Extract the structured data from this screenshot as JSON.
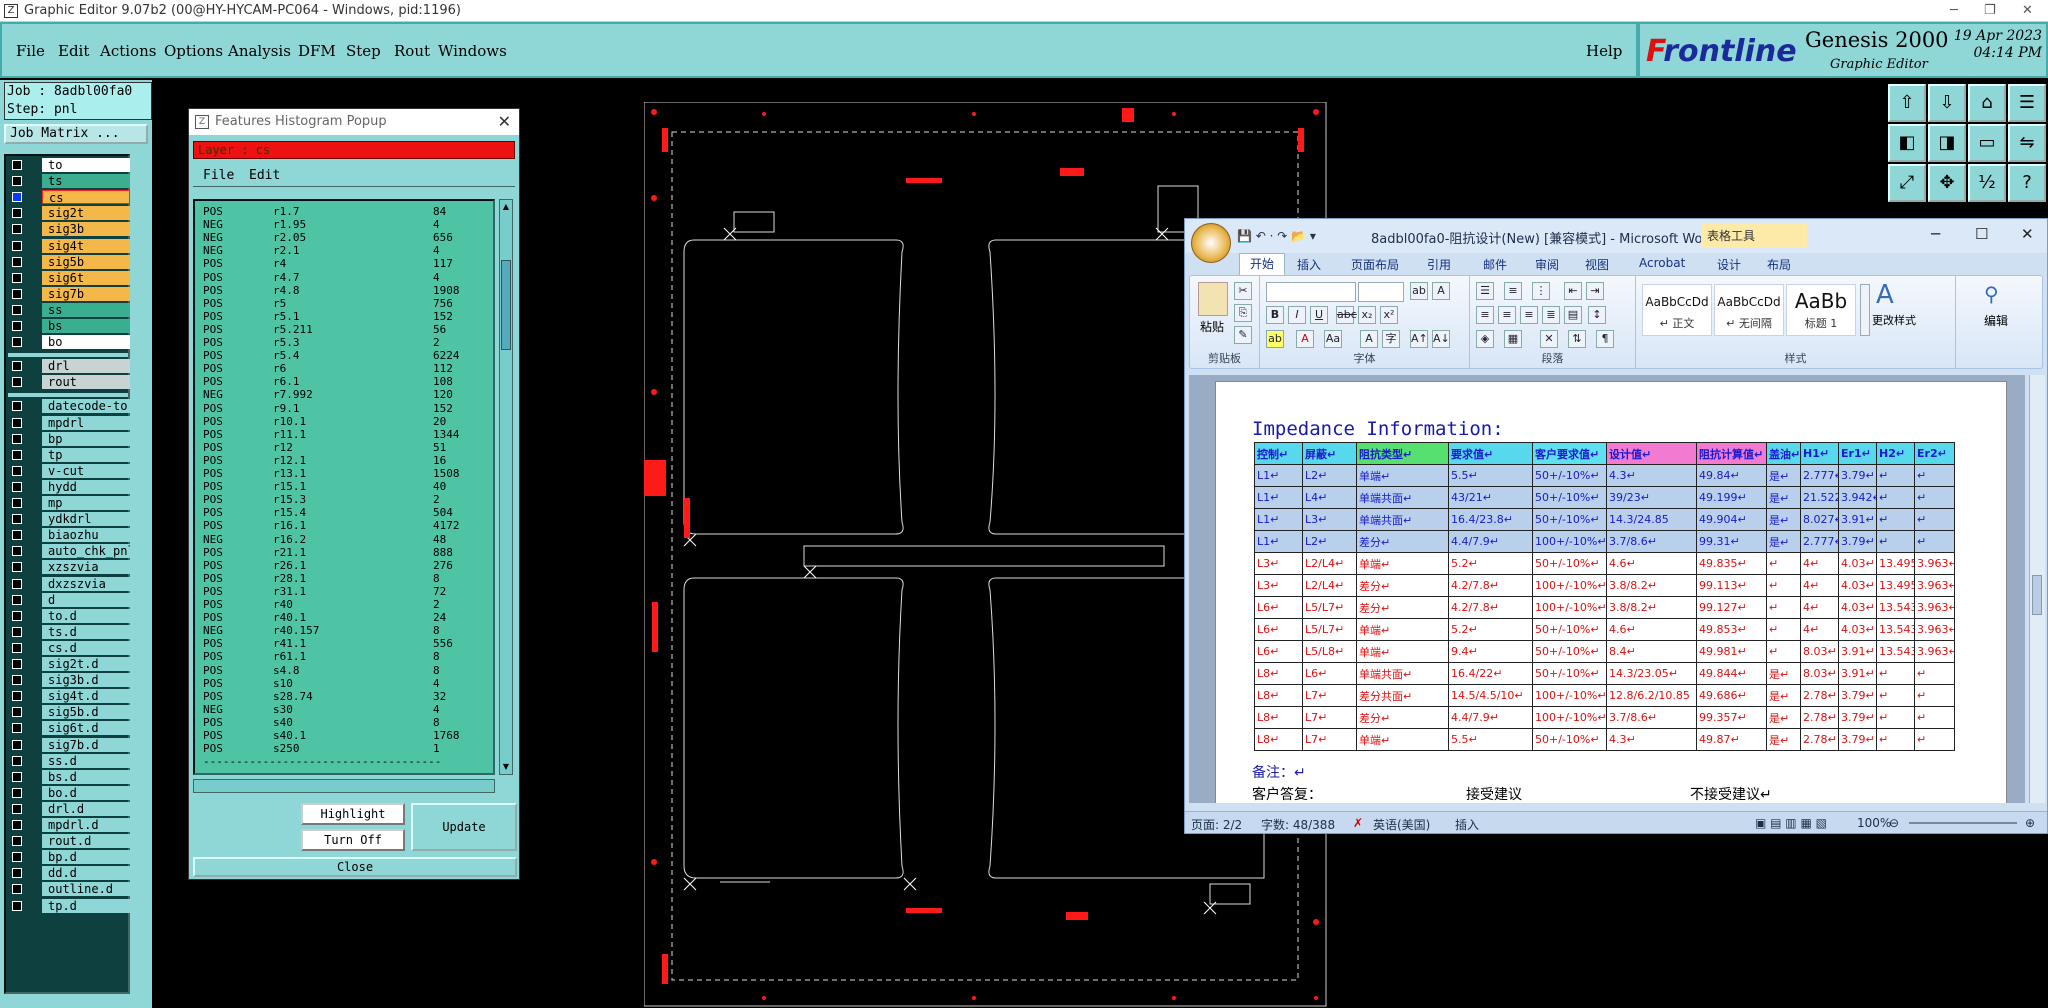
{
  "window": {
    "title": "Graphic Editor 9.07b2 (00@HY-HYCAM-PC064 - Windows, pid:1196)",
    "minimize": "─",
    "restore": "❐",
    "close": "✕"
  },
  "menu": [
    "File",
    "Edit",
    "Actions",
    "Options",
    "Analysis",
    "DFM",
    "Step",
    "Rout",
    "Windows"
  ],
  "help": "Help",
  "brand": {
    "logo_f": "F",
    "logo_rest": "rontline",
    "product": "Genesis 2000",
    "subtitle": "Graphic Editor",
    "date": "19 Apr 2023",
    "time": "04:14 PM"
  },
  "job": {
    "job_label": "Job : 8adbl00fa0",
    "step_label": "Step: pnl",
    "matrix_button": "Job Matrix ..."
  },
  "layers": [
    {
      "name": "to",
      "color": "#ffffff"
    },
    {
      "name": "ts",
      "color": "#3cae90"
    },
    {
      "name": "cs",
      "color": "#f4b84a",
      "active": true
    },
    {
      "name": "sig2t",
      "color": "#f4b84a"
    },
    {
      "name": "sig3b",
      "color": "#f4b84a"
    },
    {
      "name": "sig4t",
      "color": "#f4b84a"
    },
    {
      "name": "sig5b",
      "color": "#f4b84a"
    },
    {
      "name": "sig6t",
      "color": "#f4b84a"
    },
    {
      "name": "sig7b",
      "color": "#f4b84a"
    },
    {
      "name": "ss",
      "color": "#3cae90"
    },
    {
      "name": "bs",
      "color": "#3cae90"
    },
    {
      "name": "bo",
      "color": "#ffffff"
    }
  ],
  "drill_layers": [
    {
      "name": "drl",
      "color": "#c8d4d4"
    },
    {
      "name": "rout",
      "color": "#c8d4d4"
    }
  ],
  "misc_layers": [
    "datecode-to",
    "mpdrl",
    "bp",
    "tp",
    "v-cut",
    "hydd",
    "mp",
    "ydkdrl",
    "biaozhu",
    "auto_chk_pnl",
    "xzszvia",
    "dxzszvia",
    "d",
    "to.d",
    "ts.d",
    "cs.d",
    "sig2t.d",
    "sig3b.d",
    "sig4t.d",
    "sig5b.d",
    "sig6t.d",
    "sig7b.d",
    "ss.d",
    "bs.d",
    "bo.d",
    "drl.d",
    "mpdrl.d",
    "rout.d",
    "bp.d",
    "dd.d",
    "outline.d",
    "tp.d"
  ],
  "histogram": {
    "title": "Features Histogram Popup",
    "layer": "Layer : cs",
    "menu": [
      "File",
      "Edit"
    ],
    "rows": [
      [
        "POS",
        "r1.7",
        "84"
      ],
      [
        "NEG",
        "r1.95",
        "4"
      ],
      [
        "NEG",
        "r2.05",
        "656"
      ],
      [
        "NEG",
        "r2.1",
        "4"
      ],
      [
        "POS",
        "r4",
        "117"
      ],
      [
        "POS",
        "r4.7",
        "4"
      ],
      [
        "POS",
        "r4.8",
        "1908"
      ],
      [
        "POS",
        "r5",
        "756"
      ],
      [
        "POS",
        "r5.1",
        "152"
      ],
      [
        "POS",
        "r5.211",
        "56"
      ],
      [
        "POS",
        "r5.3",
        "2"
      ],
      [
        "POS",
        "r5.4",
        "6224"
      ],
      [
        "POS",
        "r6",
        "112"
      ],
      [
        "POS",
        "r6.1",
        "108"
      ],
      [
        "NEG",
        "r7.992",
        "120"
      ],
      [
        "POS",
        "r9.1",
        "152"
      ],
      [
        "POS",
        "r10.1",
        "20"
      ],
      [
        "POS",
        "r11.1",
        "1344"
      ],
      [
        "POS",
        "r12",
        "51"
      ],
      [
        "POS",
        "r12.1",
        "16"
      ],
      [
        "POS",
        "r13.1",
        "1508"
      ],
      [
        "POS",
        "r15.1",
        "40"
      ],
      [
        "POS",
        "r15.3",
        "2"
      ],
      [
        "POS",
        "r15.4",
        "504"
      ],
      [
        "POS",
        "r16.1",
        "4172"
      ],
      [
        "NEG",
        "r16.2",
        "48"
      ],
      [
        "POS",
        "r21.1",
        "888"
      ],
      [
        "POS",
        "r26.1",
        "276"
      ],
      [
        "POS",
        "r28.1",
        "8"
      ],
      [
        "POS",
        "r31.1",
        "72"
      ],
      [
        "POS",
        "r40",
        "2"
      ],
      [
        "POS",
        "r40.1",
        "24"
      ],
      [
        "NEG",
        "r40.157",
        "8"
      ],
      [
        "POS",
        "r41.1",
        "556"
      ],
      [
        "POS",
        "r61.1",
        "8"
      ],
      [
        "POS",
        "s4.8",
        "8"
      ],
      [
        "POS",
        "s10",
        "4"
      ],
      [
        "POS",
        "s28.74",
        "32"
      ],
      [
        "NEG",
        "s30",
        "4"
      ],
      [
        "POS",
        "s40",
        "8"
      ],
      [
        "POS",
        "s40.1",
        "1768"
      ],
      [
        "POS",
        "s250",
        "1"
      ]
    ],
    "divider": "------------------------------------",
    "buttons": {
      "highlight": "Highlight",
      "turn_off": "Turn Off",
      "update": "Update",
      "close": "Close"
    }
  },
  "word": {
    "title": "8adbl00fa0-阻抗设计(New) [兼容模式] - Microsoft Wo...",
    "context_tab": "表格工具",
    "tabs": [
      "开始",
      "插入",
      "页面布局",
      "引用",
      "邮件",
      "审阅",
      "视图",
      "Acrobat",
      "设计",
      "布局"
    ],
    "groups": {
      "clipboard": "剪贴板",
      "paste": "粘贴",
      "font": "字体",
      "paragraph": "段落",
      "styles": "样式",
      "change_styles": "更改样式",
      "editing": "编辑"
    },
    "styles": [
      {
        "sample": "AaBbCcDd",
        "name": "↵ 正文"
      },
      {
        "sample": "AaBbCcDd",
        "name": "↵ 无间隔"
      },
      {
        "sample": "AaBb",
        "name": "标题 1"
      }
    ],
    "doc_title": "Impedance Information:",
    "table_headers": [
      "控制↵",
      "屏蔽↵",
      "阻抗类型↵",
      "要求值↵",
      "客户要求值↵",
      "设计值↵",
      "阻抗计算值↵",
      "盖油↵",
      "H1↵",
      "Er1↵",
      "H2↵",
      "Er2↵"
    ],
    "table_rows": [
      [
        "L1↵",
        "L2↵",
        "单端↵",
        "5.5↵",
        "50+/-10%↵",
        "4.3↵",
        "49.84↵",
        "是↵",
        "2.777↵",
        "3.79↵",
        "↵",
        "↵"
      ],
      [
        "L1↵",
        "L4↵",
        "单端共面↵",
        "43/21↵",
        "50+/-10%↵",
        "39/23↵",
        "49.199↵",
        "是↵",
        "21.522",
        "3.942↵",
        "↵",
        "↵"
      ],
      [
        "L1↵",
        "L3↵",
        "单端共面↵",
        "16.4/23.8↵",
        "50+/-10%↵",
        "14.3/24.85",
        "49.904↵",
        "是↵",
        "8.027↵",
        "3.91↵",
        "↵",
        "↵"
      ],
      [
        "L1↵",
        "L2↵",
        "差分↵",
        "4.4/7.9↵",
        "100+/-10%↵",
        "3.7/8.6↵",
        "99.31↵",
        "是↵",
        "2.777↵",
        "3.79↵",
        "↵",
        "↵"
      ],
      [
        "L3↵",
        "L2/L4↵",
        "单端↵",
        "5.2↵",
        "50+/-10%↵",
        "4.6↵",
        "49.835↵",
        "↵",
        "4↵",
        "4.03↵",
        "13.495",
        "3.963↵"
      ],
      [
        "L3↵",
        "L2/L4↵",
        "差分↵",
        "4.2/7.8↵",
        "100+/-10%↵",
        "3.8/8.2↵",
        "99.113↵",
        "↵",
        "4↵",
        "4.03↵",
        "13.495",
        "3.963↵"
      ],
      [
        "L6↵",
        "L5/L7↵",
        "差分↵",
        "4.2/7.8↵",
        "100+/-10%↵",
        "3.8/8.2↵",
        "99.127↵",
        "↵",
        "4↵",
        "4.03↵",
        "13.543",
        "3.963↵"
      ],
      [
        "L6↵",
        "L5/L7↵",
        "单端↵",
        "5.2↵",
        "50+/-10%↵",
        "4.6↵",
        "49.853↵",
        "↵",
        "4↵",
        "4.03↵",
        "13.543",
        "3.963↵"
      ],
      [
        "L6↵",
        "L5/L8↵",
        "单端↵",
        "9.4↵",
        "50+/-10%↵",
        "8.4↵",
        "49.981↵",
        "↵",
        "8.03↵",
        "3.91↵",
        "13.543",
        "3.963↵"
      ],
      [
        "L8↵",
        "L6↵",
        "单端共面↵",
        "16.4/22↵",
        "50+/-10%↵",
        "14.3/23.05↵",
        "49.844↵",
        "是↵",
        "8.03↵",
        "3.91↵",
        "↵",
        "↵"
      ],
      [
        "L8↵",
        "L7↵",
        "差分共面↵",
        "14.5/4.5/10↵",
        "100+/-10%↵",
        "12.8/6.2/10.85",
        "49.686↵",
        "是↵",
        "2.78↵",
        "3.79↵",
        "↵",
        "↵"
      ],
      [
        "L8↵",
        "L7↵",
        "差分↵",
        "4.4/7.9↵",
        "100+/-10%↵",
        "3.7/8.6↵",
        "99.357↵",
        "是↵",
        "2.78↵",
        "3.79↵",
        "↵",
        "↵"
      ],
      [
        "L8↵",
        "L7↵",
        "单端↵",
        "5.5↵",
        "50+/-10%↵",
        "4.3↵",
        "49.87↵",
        "是↵",
        "2.78↵",
        "3.79↵",
        "↵",
        "↵"
      ]
    ],
    "notes": "备注：↵",
    "answer_label": "客户答复：",
    "accept": "接受建议",
    "reject": "不接受建议↵",
    "status": {
      "page": "页面: 2/2",
      "words": "字数: 48/388",
      "lang": "英语(美国)",
      "mode": "插入",
      "zoom": "100%"
    }
  },
  "colors": {
    "panel": "#8fd6d6",
    "feature": "#ff1a1a",
    "layer_bar": "#ee1111"
  }
}
